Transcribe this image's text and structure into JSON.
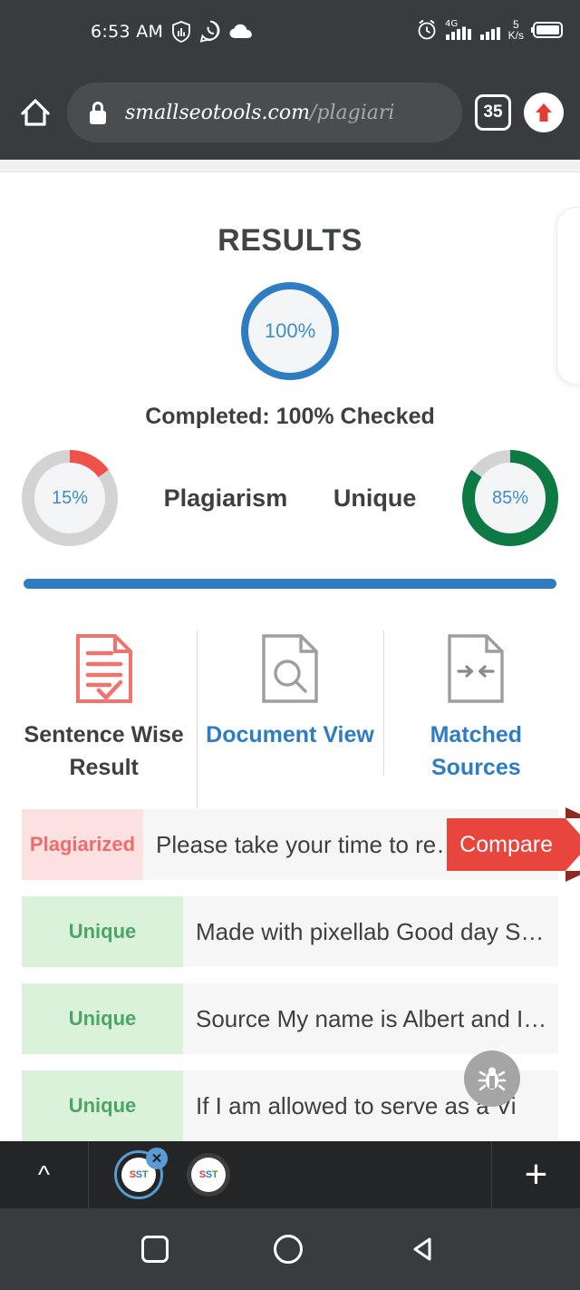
{
  "statusbar": {
    "time": "6:53 AM",
    "left_icons": [
      "shield-icon",
      "whatsapp-icon",
      "cloud-icon"
    ],
    "network_type": "4G",
    "data_rate_value": "5",
    "data_rate_unit": "K/s",
    "right_icons": [
      "alarm-icon",
      "signal-bars-icon",
      "signal-bars-2-icon",
      "battery-icon"
    ]
  },
  "browser": {
    "home_icon": "home-icon",
    "lock_icon": "lock-icon",
    "url_domain": "smallseotools.com",
    "url_path": "/plagiari",
    "tab_count": "35",
    "upload_icon": "up-arrow-icon"
  },
  "page": {
    "title": "RESULTS",
    "progress_circle": "100%",
    "completed_text": "Completed: 100% Checked",
    "plagiarism": {
      "value": "15%",
      "label": "Plagiarism",
      "color": "#f0514b"
    },
    "unique": {
      "value": "85%",
      "label": "Unique",
      "color": "#0d7a43"
    },
    "accent_blue": "#2e7cc2",
    "tabs": [
      {
        "label": "Sentence Wise Result",
        "icon": "document-check-icon",
        "active": true
      },
      {
        "label": "Document View",
        "icon": "document-search-icon",
        "active": false
      },
      {
        "label": "Matched Sources",
        "icon": "document-arrows-icon",
        "active": false
      }
    ],
    "compare_label": "Compare",
    "rows": [
      {
        "tag": "Plagiarized",
        "text": "Please take your time to re…",
        "type": "plag"
      },
      {
        "tag": "Unique",
        "text": "Made with pixellab Good day S…",
        "type": "uniq"
      },
      {
        "tag": "Unique",
        "text": "Source My name is Albert and I…",
        "type": "uniq"
      },
      {
        "tag": "Unique",
        "text": "If I am allowed to serve as a Vi",
        "type": "uniq"
      }
    ],
    "bug_icon": "bug-icon"
  },
  "tabstrip": {
    "chevron_icon": "chevron-up-icon",
    "plus_icon": "plus-icon",
    "tabs": [
      {
        "favicon": "SST",
        "selected": true,
        "close_icon": "close-icon"
      },
      {
        "favicon": "SST",
        "selected": false
      }
    ]
  },
  "navbar": {
    "recent_icon": "square-icon",
    "home_icon": "circle-icon",
    "back_icon": "triangle-back-icon"
  }
}
